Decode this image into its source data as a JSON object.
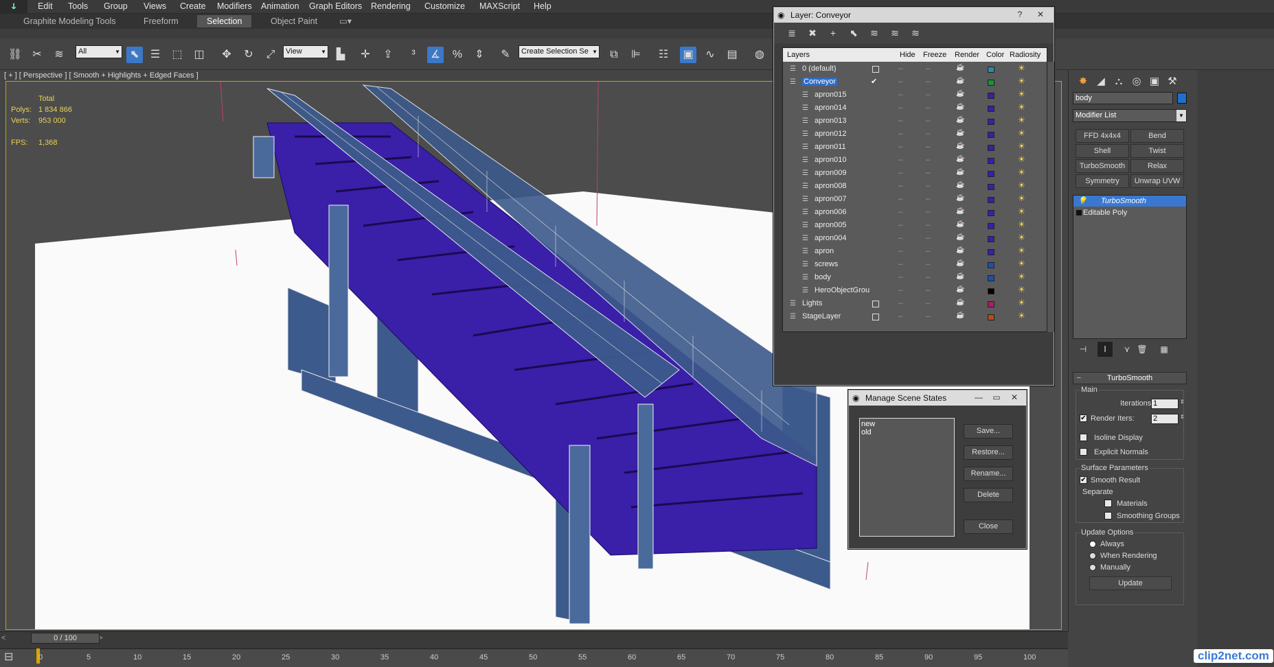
{
  "menu": [
    "Edit",
    "Tools",
    "Group",
    "Views",
    "Create",
    "Modifiers",
    "Animation",
    "Graph Editors",
    "Rendering",
    "Customize",
    "MAXScript",
    "Help"
  ],
  "ribbon_tabs": [
    "Graphite Modeling Tools",
    "Freeform",
    "Selection",
    "Object Paint"
  ],
  "ribbon_active": "Selection",
  "toolbar": {
    "filter_dropdown": "All",
    "coord_dropdown": "View",
    "selection_set": "Create Selection Se"
  },
  "viewport": {
    "label": "[ + ] [ Perspective ] [ Smooth + Highlights + Edged Faces ]",
    "stats": {
      "total_label": "Total",
      "polys_label": "Polys:",
      "polys": "1 834 866",
      "verts_label": "Verts:",
      "verts": "953 000",
      "fps_label": "FPS:",
      "fps": "1,368"
    }
  },
  "timeline": {
    "slider": "0 / 100",
    "ticks": [
      "0",
      "5",
      "10",
      "15",
      "20",
      "25",
      "30",
      "35",
      "40",
      "45",
      "50",
      "55",
      "60",
      "65",
      "70",
      "75",
      "80",
      "85",
      "90",
      "95",
      "100"
    ]
  },
  "layer_dialog": {
    "title": "Layer: Conveyor",
    "columns": [
      "Layers",
      "Hide",
      "Freeze",
      "Render",
      "Color",
      "Radiosity"
    ],
    "rows": [
      {
        "name": "0 (default)",
        "level": 0,
        "color": "#2a8aa8",
        "check": "box"
      },
      {
        "name": "Conveyor",
        "level": 0,
        "color": "#1f8f3a",
        "check": "✔",
        "selected": true
      },
      {
        "name": "apron015",
        "level": 1,
        "color": "#3a1fa8"
      },
      {
        "name": "apron014",
        "level": 1,
        "color": "#3a1fa8"
      },
      {
        "name": "apron013",
        "level": 1,
        "color": "#3a1fa8"
      },
      {
        "name": "apron012",
        "level": 1,
        "color": "#3a1fa8"
      },
      {
        "name": "apron011",
        "level": 1,
        "color": "#3a1fa8"
      },
      {
        "name": "apron010",
        "level": 1,
        "color": "#3a1fa8"
      },
      {
        "name": "apron009",
        "level": 1,
        "color": "#3a1fa8"
      },
      {
        "name": "apron008",
        "level": 1,
        "color": "#3a1fa8"
      },
      {
        "name": "apron007",
        "level": 1,
        "color": "#3a1fa8"
      },
      {
        "name": "apron006",
        "level": 1,
        "color": "#3a1fa8"
      },
      {
        "name": "apron005",
        "level": 1,
        "color": "#3a1fa8"
      },
      {
        "name": "apron004",
        "level": 1,
        "color": "#3a1fa8"
      },
      {
        "name": "apron",
        "level": 1,
        "color": "#3a1fa8"
      },
      {
        "name": "screws",
        "level": 1,
        "color": "#1f4fa8"
      },
      {
        "name": "body",
        "level": 1,
        "color": "#1f4fa8"
      },
      {
        "name": "HeroObjectGrou",
        "level": 1,
        "color": "#000000"
      },
      {
        "name": "Lights",
        "level": 0,
        "color": "#a81f6a",
        "check": "box"
      },
      {
        "name": "StageLayer",
        "level": 0,
        "color": "#b84a1a",
        "check": "box"
      }
    ]
  },
  "scene_states": {
    "title": "Manage Scene States",
    "list": [
      "new",
      "old"
    ],
    "buttons": [
      "Save...",
      "Restore...",
      "Rename...",
      "Delete",
      "Close"
    ]
  },
  "command_panel": {
    "object_name": "body",
    "object_color": "#1f6fd0",
    "modifier_list": "Modifier List",
    "modifier_buttons": [
      "FFD 4x4x4",
      "Bend",
      "Shell",
      "Twist",
      "TurboSmooth",
      "Relax",
      "Symmetry",
      "Unwrap UVW"
    ],
    "stack": [
      "TurboSmooth",
      "Editable Poly"
    ],
    "rollout_title": "TurboSmooth",
    "main_label": "Main",
    "iterations_label": "Iterations:",
    "iterations": "1",
    "render_iters_label": "Render Iters:",
    "render_iters": "2",
    "isoline": "Isoline Display",
    "explicit_normals": "Explicit Normals",
    "surface_params": "Surface Parameters",
    "smooth_result": "Smooth Result",
    "separate": "Separate",
    "materials": "Materials",
    "smoothing_groups": "Smoothing Groups",
    "update_options": "Update Options",
    "always": "Always",
    "when_rendering": "When Rendering",
    "manually": "Manually",
    "update_button": "Update"
  },
  "watermark": "clip2net.com"
}
